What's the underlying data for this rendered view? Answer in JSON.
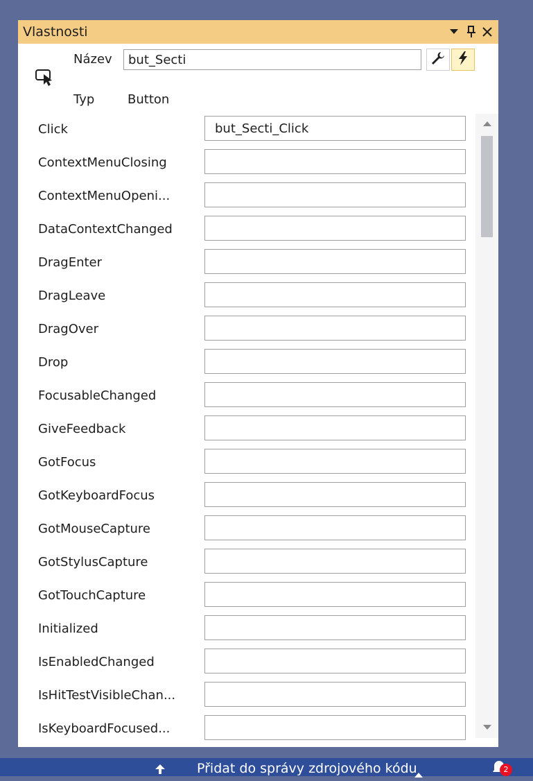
{
  "panel": {
    "title": "Vlastnosti",
    "icons": {
      "dropdown": "triangle-down-icon",
      "pin": "pin-icon",
      "close": "close-icon"
    },
    "accent_color": "#f5cc84"
  },
  "header": {
    "selection_icon": "pointer-select-icon",
    "name_label": "Název",
    "name_value": "but_Secti",
    "type_label": "Typ",
    "type_value": "Button",
    "properties_button_icon": "wrench-icon",
    "events_button_icon": "lightning-icon"
  },
  "events": [
    {
      "name": "Click",
      "handler": "but_Secti_Click"
    },
    {
      "name": "ContextMenuClosing",
      "handler": ""
    },
    {
      "name": "ContextMenuOpeni...",
      "handler": ""
    },
    {
      "name": "DataContextChanged",
      "handler": ""
    },
    {
      "name": "DragEnter",
      "handler": ""
    },
    {
      "name": "DragLeave",
      "handler": ""
    },
    {
      "name": "DragOver",
      "handler": ""
    },
    {
      "name": "Drop",
      "handler": ""
    },
    {
      "name": "FocusableChanged",
      "handler": ""
    },
    {
      "name": "GiveFeedback",
      "handler": ""
    },
    {
      "name": "GotFocus",
      "handler": ""
    },
    {
      "name": "GotKeyboardFocus",
      "handler": ""
    },
    {
      "name": "GotMouseCapture",
      "handler": ""
    },
    {
      "name": "GotStylusCapture",
      "handler": ""
    },
    {
      "name": "GotTouchCapture",
      "handler": ""
    },
    {
      "name": "Initialized",
      "handler": ""
    },
    {
      "name": "IsEnabledChanged",
      "handler": ""
    },
    {
      "name": "IsHitTestVisibleChan...",
      "handler": ""
    },
    {
      "name": "IsKeyboardFocused...",
      "handler": ""
    }
  ],
  "statusbar": {
    "source_control_text": "Přidat do správy zdrojového kódu",
    "notification_count": "2",
    "background": "#2e4e9a"
  }
}
